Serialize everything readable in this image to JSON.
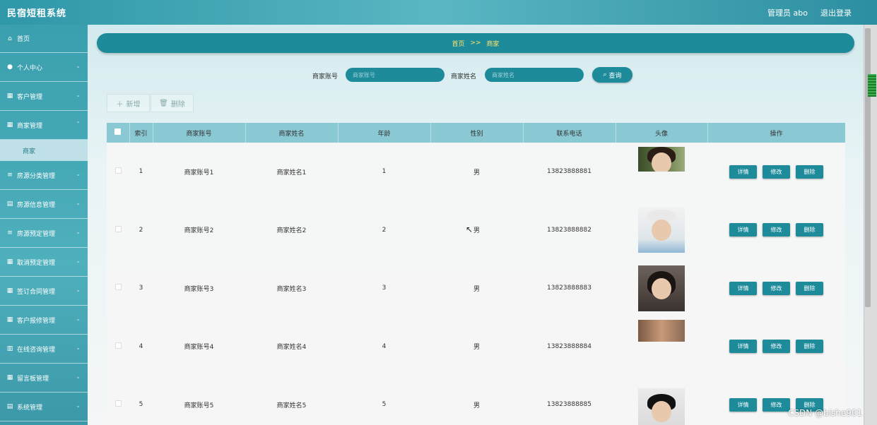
{
  "app": {
    "title": "民宿短租系统",
    "user_label": "管理员 abo",
    "logout_label": "退出登录"
  },
  "sidebar": {
    "items": [
      {
        "label": "首页",
        "icon": "home-icon",
        "chevron": false
      },
      {
        "label": "个人中心",
        "icon": "user-icon",
        "chevron": true
      },
      {
        "label": "客户管理",
        "icon": "grid-icon",
        "chevron": true
      },
      {
        "label": "商家管理",
        "icon": "grid-icon",
        "chevron": true
      },
      {
        "label": "房源分类管理",
        "icon": "list-icon",
        "chevron": true
      },
      {
        "label": "房源信息管理",
        "icon": "building-icon",
        "chevron": true
      },
      {
        "label": "房源预定管理",
        "icon": "list-icon",
        "chevron": true
      },
      {
        "label": "取消预定管理",
        "icon": "grid-icon",
        "chevron": true
      },
      {
        "label": "签订合同管理",
        "icon": "grid-icon",
        "chevron": true
      },
      {
        "label": "客户报修管理",
        "icon": "grid-icon",
        "chevron": true
      },
      {
        "label": "在线咨询管理",
        "icon": "chart-icon",
        "chevron": true
      },
      {
        "label": "留言板管理",
        "icon": "grid-icon",
        "chevron": true
      },
      {
        "label": "系统管理",
        "icon": "building-icon",
        "chevron": true
      }
    ],
    "sub_item": "商家"
  },
  "breadcrumb": {
    "home": "首页",
    "sep": ">>",
    "current": "商家"
  },
  "search": {
    "account_label": "商家账号",
    "account_placeholder": "商家账号",
    "name_label": "商家姓名",
    "name_placeholder": "商家姓名",
    "query_label": "查询"
  },
  "actions": {
    "add_label": "新增",
    "delete_label": "删除"
  },
  "table": {
    "headers": [
      "",
      "索引",
      "商家账号",
      "商家姓名",
      "年龄",
      "性别",
      "联系电话",
      "头像",
      "操作"
    ],
    "rows": [
      {
        "index": "1",
        "account": "商家账号1",
        "name": "商家姓名1",
        "age": "1",
        "gender": "男",
        "phone": "13823888881"
      },
      {
        "index": "2",
        "account": "商家账号2",
        "name": "商家姓名2",
        "age": "2",
        "gender": "男",
        "phone": "13823888882"
      },
      {
        "index": "3",
        "account": "商家账号3",
        "name": "商家姓名3",
        "age": "3",
        "gender": "男",
        "phone": "13823888883"
      },
      {
        "index": "4",
        "account": "商家账号4",
        "name": "商家姓名4",
        "age": "4",
        "gender": "男",
        "phone": "13823888884"
      },
      {
        "index": "5",
        "account": "商家账号5",
        "name": "商家姓名5",
        "age": "5",
        "gender": "男",
        "phone": "13823888885"
      }
    ],
    "op_labels": {
      "detail": "详情",
      "edit": "修改",
      "delete": "删除"
    }
  },
  "watermark": "CSDN @bishe901",
  "colors": {
    "accent": "#1e8b9a",
    "header_row": "#8ac9d4",
    "breadcrumb_text": "#ffe16b"
  }
}
